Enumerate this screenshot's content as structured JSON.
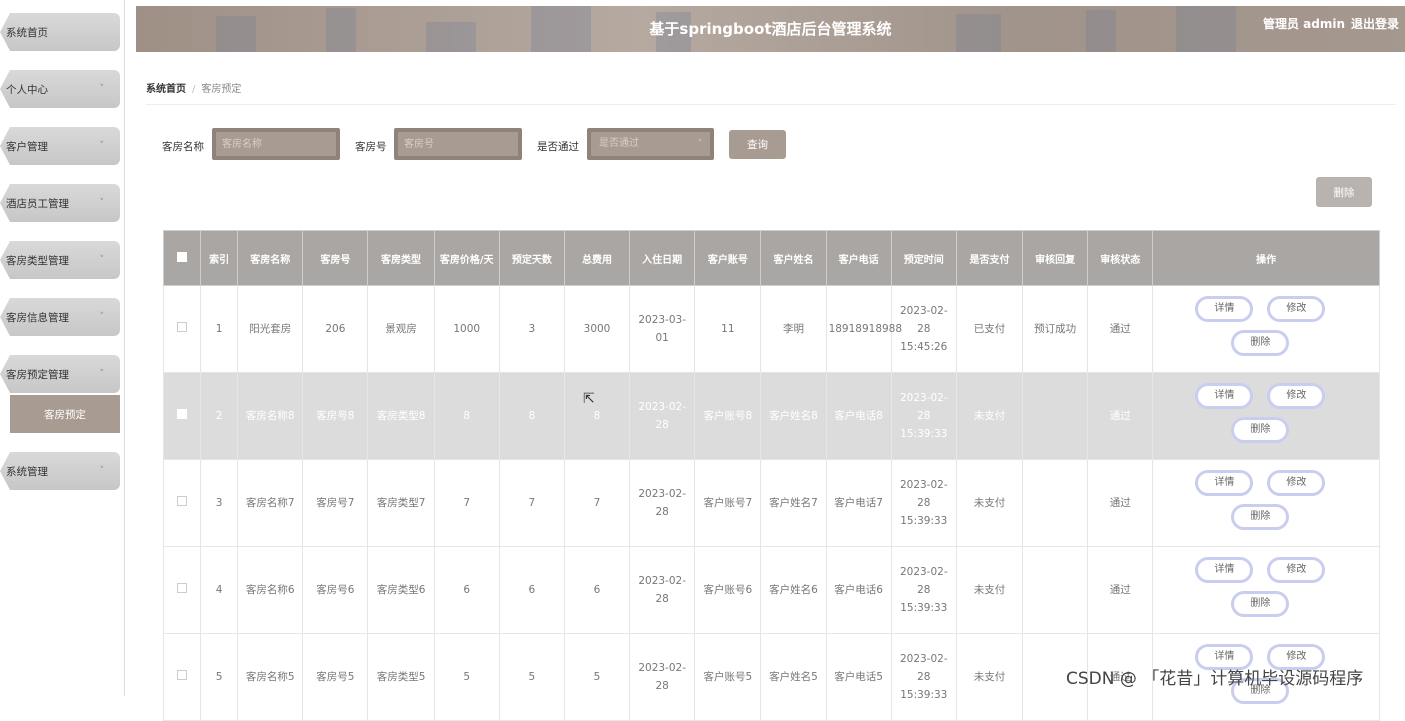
{
  "sidebar": {
    "items": [
      {
        "label": "系统首页",
        "chevron": ""
      },
      {
        "label": "个人中心",
        "chevron": "˅"
      },
      {
        "label": "客户管理",
        "chevron": "˅"
      },
      {
        "label": "酒店员工管理",
        "chevron": "˅"
      },
      {
        "label": "客房类型管理",
        "chevron": "˅"
      },
      {
        "label": "客房信息管理",
        "chevron": "˅"
      },
      {
        "label": "客房预定管理",
        "chevron": "˄"
      },
      {
        "label": "系统管理",
        "chevron": "˅"
      }
    ],
    "subitem": "客房预定"
  },
  "header": {
    "title": "基于springboot酒店后台管理系统",
    "admin": "管理员 admin",
    "logout": "退出登录"
  },
  "breadcrumb": {
    "home": "系统首页",
    "sep": "/",
    "current": "客房预定"
  },
  "search": {
    "room_name_label": "客房名称",
    "room_name_placeholder": "客房名称",
    "room_no_label": "客房号",
    "room_no_placeholder": "客房号",
    "passed_label": "是否通过",
    "passed_placeholder": "是否通过",
    "query": "查询"
  },
  "toolbar": {
    "delete": "删除"
  },
  "table": {
    "headers": [
      "",
      "索引",
      "客房名称",
      "客房号",
      "客房类型",
      "客房价格/天",
      "预定天数",
      "总费用",
      "入住日期",
      "客户账号",
      "客户姓名",
      "客户电话",
      "预定时间",
      "是否支付",
      "审核回复",
      "审核状态",
      "操作"
    ],
    "rows": [
      {
        "idx": "1",
        "name": "阳光套房",
        "no": "206",
        "type": "景观房",
        "price": "1000",
        "days": "3",
        "total": "3000",
        "checkin": "2023-03-01",
        "account": "11",
        "cname": "李明",
        "phone": "18918918988",
        "time": "2023-02-28 15:45:26",
        "paid": "已支付",
        "reply": "预订成功",
        "status": "通过",
        "highlight": false
      },
      {
        "idx": "2",
        "name": "客房名称8",
        "no": "客房号8",
        "type": "客房类型8",
        "price": "8",
        "days": "8",
        "total": "8",
        "checkin": "2023-02-28",
        "account": "客户账号8",
        "cname": "客户姓名8",
        "phone": "客户电话8",
        "time": "2023-02-28 15:39:33",
        "paid": "未支付",
        "reply": "",
        "status": "通过",
        "highlight": true
      },
      {
        "idx": "3",
        "name": "客房名称7",
        "no": "客房号7",
        "type": "客房类型7",
        "price": "7",
        "days": "7",
        "total": "7",
        "checkin": "2023-02-28",
        "account": "客户账号7",
        "cname": "客户姓名7",
        "phone": "客户电话7",
        "time": "2023-02-28 15:39:33",
        "paid": "未支付",
        "reply": "",
        "status": "通过",
        "highlight": false
      },
      {
        "idx": "4",
        "name": "客房名称6",
        "no": "客房号6",
        "type": "客房类型6",
        "price": "6",
        "days": "6",
        "total": "6",
        "checkin": "2023-02-28",
        "account": "客户账号6",
        "cname": "客户姓名6",
        "phone": "客户电话6",
        "time": "2023-02-28 15:39:33",
        "paid": "未支付",
        "reply": "",
        "status": "通过",
        "highlight": false
      },
      {
        "idx": "5",
        "name": "客房名称5",
        "no": "客房号5",
        "type": "客房类型5",
        "price": "5",
        "days": "5",
        "total": "5",
        "checkin": "2023-02-28",
        "account": "客户账号5",
        "cname": "客户姓名5",
        "phone": "客户电话5",
        "time": "2023-02-28 15:39:33",
        "paid": "未支付",
        "reply": "",
        "status": "通过",
        "highlight": false
      }
    ],
    "actions": {
      "detail": "详情",
      "edit": "修改",
      "delete": "删除"
    }
  },
  "watermark": "CSDN @ 「花昔」计算机毕设源码程序"
}
